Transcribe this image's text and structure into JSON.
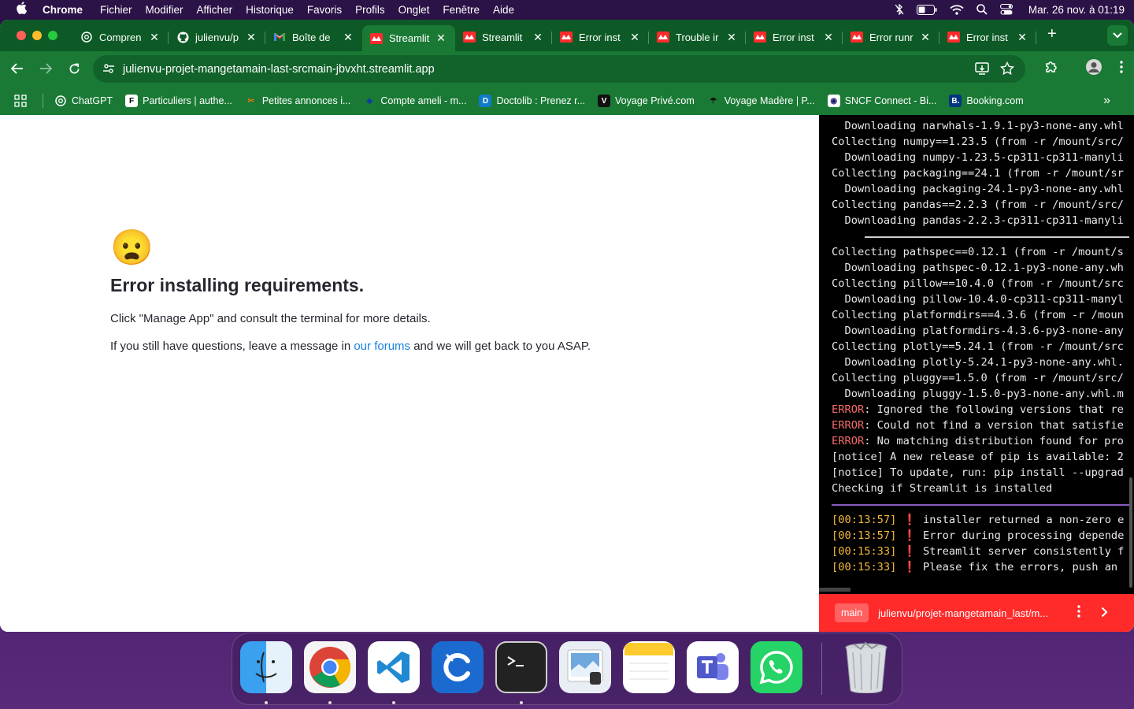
{
  "menubar": {
    "app": "Chrome",
    "items": [
      "Fichier",
      "Modifier",
      "Afficher",
      "Historique",
      "Favoris",
      "Profils",
      "Onglet",
      "Fenêtre",
      "Aide"
    ],
    "clock": "Mar. 26 nov. à  01:19"
  },
  "tabs": [
    {
      "title": "Compren",
      "icon": "openai-icon"
    },
    {
      "title": "julienvu/p",
      "icon": "github-icon"
    },
    {
      "title": "Boîte de",
      "icon": "gmail-icon"
    },
    {
      "title": "Streamlit",
      "icon": "streamlit-icon",
      "active": true
    },
    {
      "title": "Streamlit",
      "icon": "streamlit-icon"
    },
    {
      "title": "Error inst",
      "icon": "streamlit-icon"
    },
    {
      "title": "Trouble ir",
      "icon": "streamlit-icon"
    },
    {
      "title": "Error inst",
      "icon": "streamlit-icon"
    },
    {
      "title": "Error runr",
      "icon": "streamlit-icon"
    },
    {
      "title": "Error inst",
      "icon": "streamlit-icon"
    }
  ],
  "address": {
    "url": "julienvu-projet-mangetamain-last-srcmain-jbvxht.streamlit.app"
  },
  "bookmarks": [
    {
      "label": "ChatGPT",
      "icon": "openai-icon"
    },
    {
      "label": "Particuliers | authe...",
      "icon": "particuliers-icon"
    },
    {
      "label": "Petites annonces i...",
      "icon": "leboncoin-icon"
    },
    {
      "label": "Compte ameli - m...",
      "icon": "ameli-icon"
    },
    {
      "label": "Doctolib : Prenez r...",
      "icon": "doctolib-icon"
    },
    {
      "label": "Voyage Privé.com",
      "icon": "voyage-prive-icon"
    },
    {
      "label": "Voyage Madère | P...",
      "icon": "voyage-madere-icon"
    },
    {
      "label": "SNCF Connect - Bi...",
      "icon": "sncf-icon"
    },
    {
      "label": "Booking.com",
      "icon": "booking-icon"
    }
  ],
  "page": {
    "emoji": "😦",
    "title": "Error installing requirements.",
    "line1": "Click \"Manage App\" and consult the terminal for more details.",
    "line2_before": "If you still have questions, leave a message in ",
    "line2_link": "our forums",
    "line2_after": " and we will get back to you ASAP."
  },
  "terminal": {
    "lines": [
      "  Downloading narwhals-1.9.1-py3-none-any.whl",
      "Collecting numpy==1.23.5 (from -r /mount/src/",
      "  Downloading numpy-1.23.5-cp311-cp311-manyli",
      "Collecting packaging==24.1 (from -r /mount/sr",
      "  Downloading packaging-24.1-py3-none-any.whl",
      "Collecting pandas==2.2.3 (from -r /mount/src/",
      "  Downloading pandas-2.2.3-cp311-cp311-manyli",
      "",
      "Collecting pathspec==0.12.1 (from -r /mount/s",
      "  Downloading pathspec-0.12.1-py3-none-any.wh",
      "Collecting pillow==10.4.0 (from -r /mount/src",
      "  Downloading pillow-10.4.0-cp311-cp311-manyl",
      "Collecting platformdirs==4.3.6 (from -r /moun",
      "  Downloading platformdirs-4.3.6-py3-none-any",
      "Collecting plotly==5.24.1 (from -r /mount/src",
      "  Downloading plotly-5.24.1-py3-none-any.whl.",
      "Collecting pluggy==1.5.0 (from -r /mount/src/",
      "  Downloading pluggy-1.5.0-py3-none-any.whl.m"
    ],
    "errors": [
      {
        "tag": "ERROR",
        "text": ": Ignored the following versions that re"
      },
      {
        "tag": "ERROR",
        "text": ": Could not find a version that satisfie"
      },
      {
        "tag": "ERROR",
        "text": ": No matching distribution found for pro"
      }
    ],
    "notices": [
      "[notice] A new release of pip is available: 2",
      "[notice] To update, run: pip install --upgrad",
      "Checking if Streamlit is installed"
    ],
    "logs": [
      {
        "time": "[00:13:57]",
        "mark": "❗",
        "text": "installer returned a non-zero e"
      },
      {
        "time": "[00:13:57]",
        "mark": "❗",
        "text": "Error during processing depende"
      },
      {
        "time": "[00:15:33]",
        "mark": "❗",
        "text": "Streamlit server consistently f"
      },
      {
        "time": "[00:15:33]",
        "mark": "❗",
        "text": "Please fix the errors, push an"
      }
    ]
  },
  "statusbar": {
    "branch": "main",
    "repo": "julienvu/projet-mangetamain_last/m..."
  },
  "dock": [
    "finder-icon",
    "chrome-icon",
    "vscode-icon",
    "cleanmymac-icon",
    "terminal-icon",
    "preview-icon",
    "notes-icon",
    "teams-icon",
    "whatsapp-icon",
    "trash-icon"
  ],
  "colors": {
    "tab_bg": "#0d5a26",
    "toolbar_bg": "#1a7a35",
    "streamlit_red": "#ff2b2b",
    "link": "#1c83e1"
  }
}
